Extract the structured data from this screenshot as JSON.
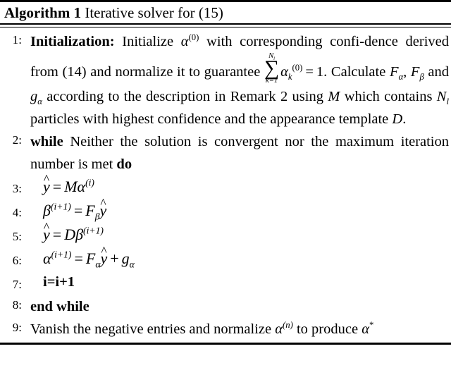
{
  "document": {
    "kind": "algorithm-pseudocode-block",
    "title_label": "Algorithm 1",
    "title_caption": "Iterative solver for (15)"
  },
  "steps": [
    {
      "number": "1:",
      "indent": "normal",
      "keyword": "Initialization:",
      "text_part1": "Initialize",
      "alpha_symbol": "α",
      "alpha_sup": "(0)",
      "text_part2": "with corresponding confi-dence derived from (14) and normalize it to guarantee",
      "sum_top": "N",
      "sum_top_sub": "l",
      "sum_sign": "∑",
      "sum_bottom": "k=1",
      "sum_term_symbol": "α",
      "sum_term_sub": "k",
      "sum_term_sup": "(0)",
      "equals": "=",
      "sum_value": "1.",
      "text_part3": "Calculate",
      "F_alpha": "F",
      "F_alpha_sub": "α",
      "comma": ",",
      "F_beta": "F",
      "F_beta_sub": "β",
      "text_and": "and",
      "g_alpha": "g",
      "g_alpha_sub": "α",
      "text_part4": "according to the description in Remark 2 using",
      "M_symbol": "M",
      "text_part5": "which contains",
      "Nl_symbol": "N",
      "Nl_sub": "l",
      "text_part6": "particles with highest confidence and the appearance template",
      "D_symbol": "D",
      "period": "."
    },
    {
      "number": "2:",
      "indent": "normal",
      "keyword_while": "while",
      "text": "Neither the solution is convergent nor the maximum iteration number is met",
      "keyword_do": "do"
    },
    {
      "number": "3:",
      "indent": "deep",
      "equation": "ŷ = Mα^(i)",
      "lhs_hat_var": "y",
      "lhs_hat": "̂",
      "eq_op": "=",
      "rhs_M": "M",
      "rhs_alpha": "α",
      "rhs_alpha_sup": "(i)"
    },
    {
      "number": "4:",
      "indent": "deep",
      "equation": "β^(i+1) = Fβŷ",
      "lhs_beta": "β",
      "lhs_beta_sup": "(i+1)",
      "eq_op": "=",
      "rhs_F": "F",
      "rhs_F_sub": "β",
      "rhs_hat_var": "y"
    },
    {
      "number": "5:",
      "indent": "deep",
      "equation": "ŷ = Dβ^(i+1)",
      "lhs_hat_var": "y",
      "eq_op": "=",
      "rhs_D": "D",
      "rhs_beta": "β",
      "rhs_beta_sup": "(i+1)"
    },
    {
      "number": "6:",
      "indent": "deep",
      "equation": "α^(i+1) = Fαŷ + gα",
      "lhs_alpha": "α",
      "lhs_alpha_sup": "(i+1)",
      "eq_op": "=",
      "rhs_F": "F",
      "rhs_F_sub": "α",
      "rhs_hat_var": "y",
      "plus": "+",
      "rhs_g": "g",
      "rhs_g_sub": "α"
    },
    {
      "number": "7:",
      "indent": "deep",
      "text": "i=i+1"
    },
    {
      "number": "8:",
      "indent": "normal",
      "keyword": "end while"
    },
    {
      "number": "9:",
      "indent": "normal",
      "text_part1": "Vanish the negative entries and normalize",
      "alpha_symbol": "α",
      "alpha_sup": "(n)",
      "text_part2": "to produce",
      "alpha_star_symbol": "α",
      "alpha_star_sup": "*"
    }
  ],
  "colors": {
    "ink": "#000000",
    "background": "#ffffff"
  }
}
